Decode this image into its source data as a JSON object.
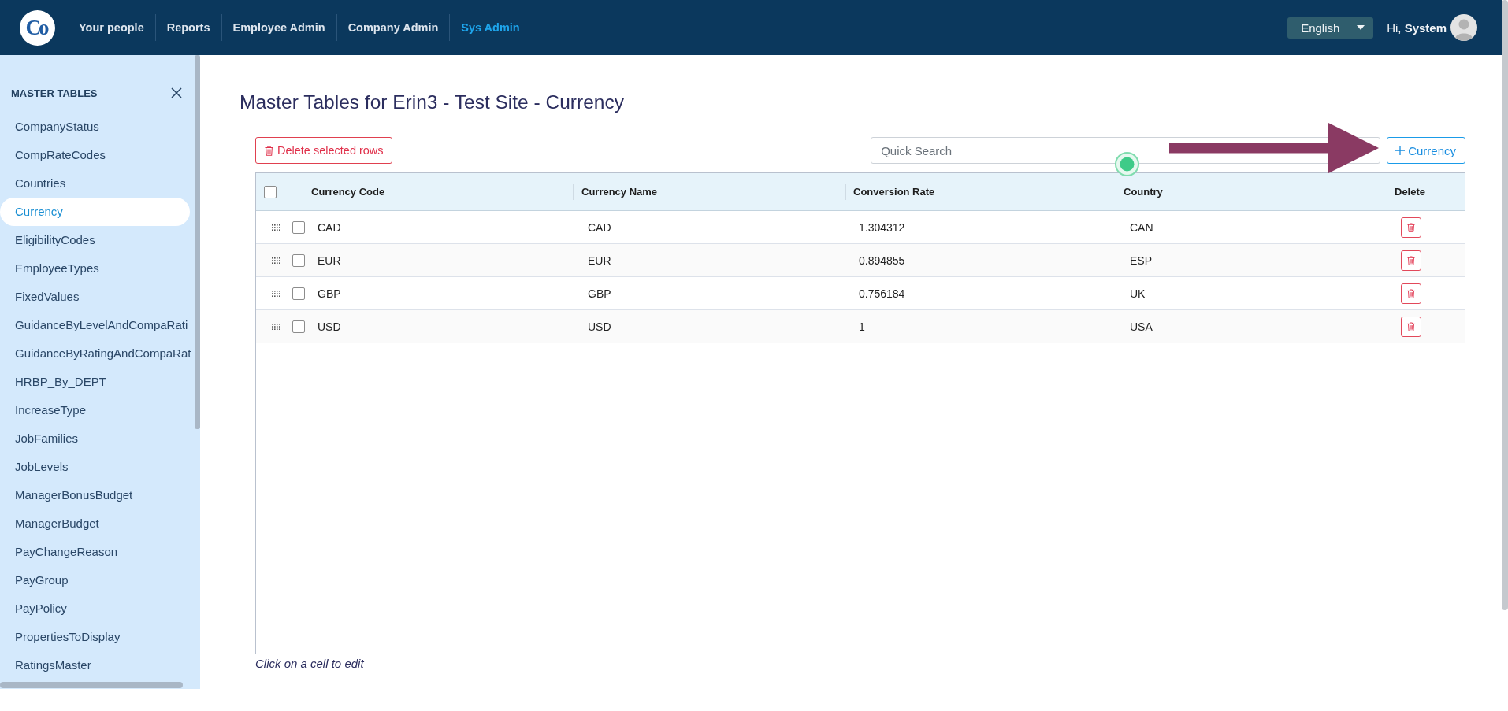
{
  "top_bar": {
    "logo": "Co",
    "nav": [
      {
        "label": "Your people",
        "selected": false
      },
      {
        "label": "Reports",
        "selected": false
      },
      {
        "label": "Employee Admin",
        "selected": false
      },
      {
        "label": "Company Admin",
        "selected": false
      },
      {
        "label": "Sys Admin",
        "selected": true
      }
    ],
    "language": "English",
    "greeting": "Hi, **System**"
  },
  "sidebar": {
    "title": "MASTER TABLES",
    "items": [
      {
        "label": "CompanyStatus",
        "selected": false
      },
      {
        "label": "CompRateCodes",
        "selected": false
      },
      {
        "label": "Countries",
        "selected": false
      },
      {
        "label": "Currency",
        "selected": true
      },
      {
        "label": "EligibilityCodes",
        "selected": false
      },
      {
        "label": "EmployeeTypes",
        "selected": false
      },
      {
        "label": "FixedValues",
        "selected": false
      },
      {
        "label": "GuidanceByLevelAndCompaRati",
        "selected": false
      },
      {
        "label": "GuidanceByRatingAndCompaRat",
        "selected": false
      },
      {
        "label": "HRBP_By_DEPT",
        "selected": false
      },
      {
        "label": "IncreaseType",
        "selected": false
      },
      {
        "label": "JobFamilies",
        "selected": false
      },
      {
        "label": "JobLevels",
        "selected": false
      },
      {
        "label": "ManagerBonusBudget",
        "selected": false
      },
      {
        "label": "ManagerBudget",
        "selected": false
      },
      {
        "label": "PayChangeReason",
        "selected": false
      },
      {
        "label": "PayGroup",
        "selected": false
      },
      {
        "label": "PayPolicy",
        "selected": false
      },
      {
        "label": "PropertiesToDisplay",
        "selected": false
      },
      {
        "label": "RatingsMaster",
        "selected": false
      }
    ]
  },
  "page": {
    "title": "Master Tables for Erin3 - Test Site - Currency",
    "delete_selected_button": "Delete selected rows",
    "search": {
      "placeholder": "Quick Search"
    },
    "add_button": "Currency"
  },
  "table": {
    "select_all_checked": false,
    "columns": [
      "Currency Code",
      "Currency Name",
      "Conversion Rate",
      "Country",
      "Delete"
    ],
    "rows": [
      {
        "checked": false,
        "cells": [
          "CAD",
          "CAD",
          "1.304312",
          "CAN"
        ]
      },
      {
        "checked": false,
        "cells": [
          "EUR",
          "EUR",
          "0.894855",
          "ESP"
        ]
      },
      {
        "checked": false,
        "cells": [
          "GBP",
          "GBP",
          "0.756184",
          "UK"
        ]
      },
      {
        "checked": false,
        "cells": [
          "USD",
          "USD",
          "1",
          "USA"
        ]
      }
    ]
  },
  "hint": "Click on a cell to edit"
}
